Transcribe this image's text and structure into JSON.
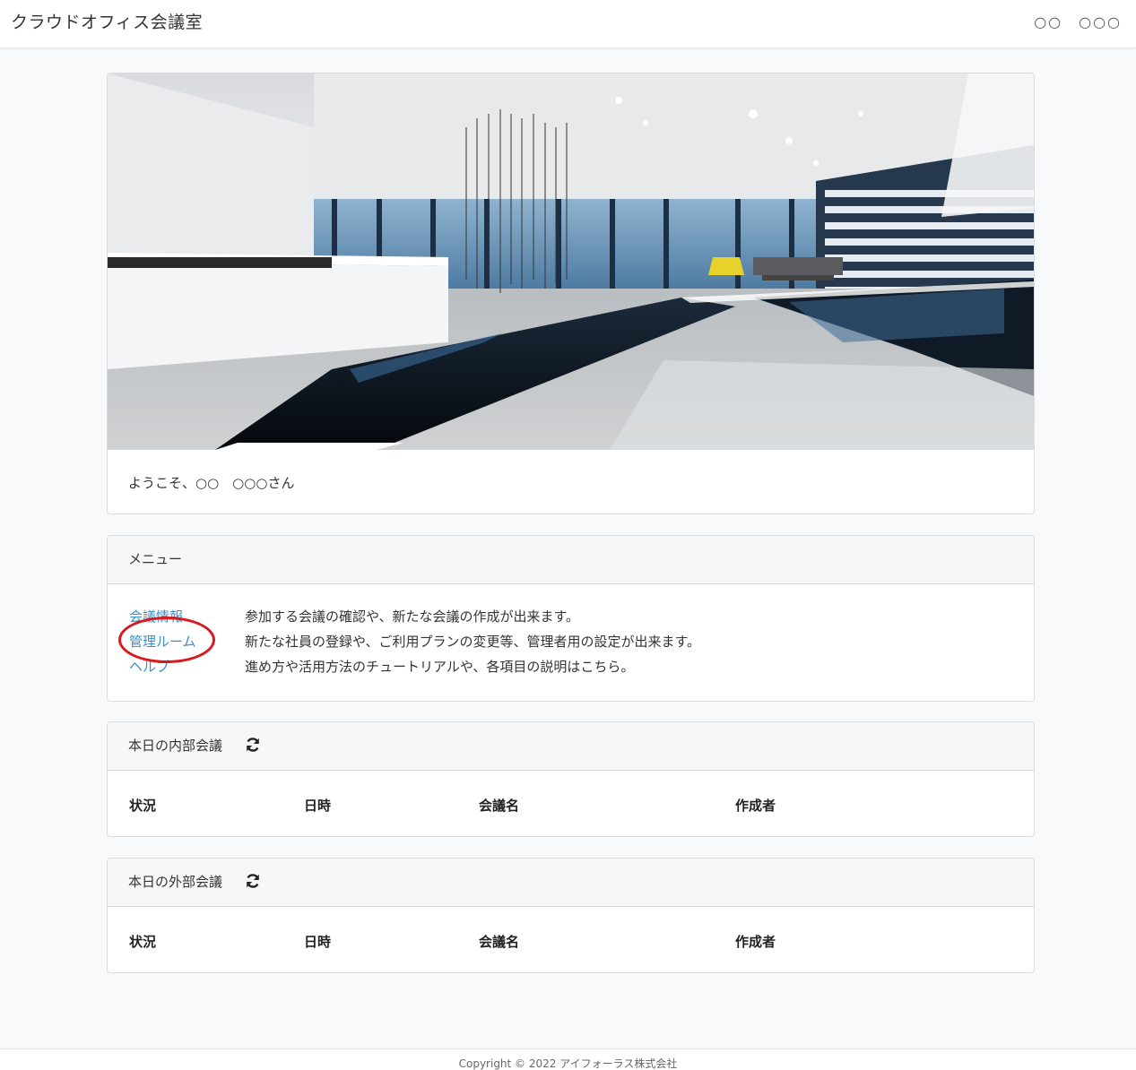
{
  "header": {
    "brand": "クラウドオフィス会議室",
    "user": "○○　○○○"
  },
  "welcome": "ようこそ、○○　○○○さん",
  "menu": {
    "title": "メニュー",
    "items": [
      {
        "label": "会議情報",
        "description": "参加する会議の確認や、新たな会議の作成が出来ます。"
      },
      {
        "label": "管理ルーム",
        "description": "新たな社員の登録や、ご利用プランの変更等、管理者用の設定が出来ます。"
      },
      {
        "label": "ヘルプ",
        "description": "進め方や活用方法のチュートリアルや、各項目の説明はこちら。"
      }
    ]
  },
  "internal": {
    "title": "本日の内部会議",
    "columns": [
      "状況",
      "日時",
      "会議名",
      "作成者"
    ]
  },
  "external": {
    "title": "本日の外部会議",
    "columns": [
      "状況",
      "日時",
      "会議名",
      "作成者"
    ]
  },
  "footer": {
    "copyright": "Copyright © 2022 アイフォーラス株式会社"
  },
  "colors": {
    "link": "#3a8fc4",
    "highlight_circle": "#d8191d"
  },
  "icons": {
    "refresh": "refresh-icon"
  }
}
